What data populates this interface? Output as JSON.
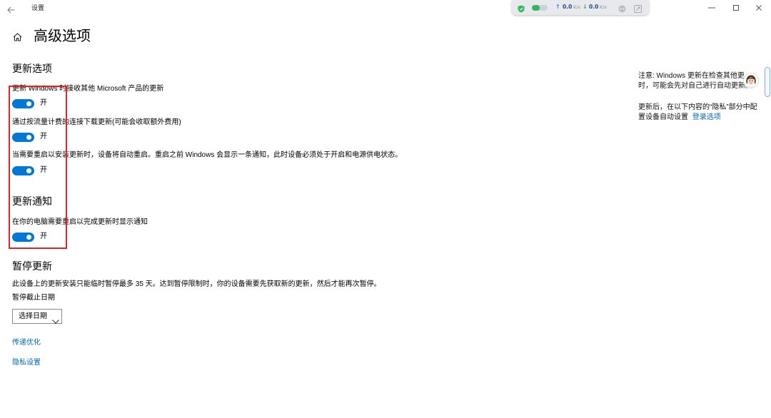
{
  "window": {
    "title": "设置"
  },
  "net_monitor": {
    "upload_value": "0.0",
    "upload_unit": "K/s",
    "download_value": "0.0",
    "download_unit": "K/s"
  },
  "page": {
    "title": "高级选项"
  },
  "update_options": {
    "heading": "更新选项",
    "toggles": [
      {
        "label": "更新 Windows 时接收其他 Microsoft 产品的更新",
        "on": true,
        "state_label": "开"
      },
      {
        "label": "通过按流量计费的连接下载更新(可能会收取额外费用)",
        "on": true,
        "state_label": "开"
      },
      {
        "label": "当需要重启以安装更新时，设备将自动重启。重启之前 Windows 会显示一条通知，此时设备必须处于开启和电源供电状态。",
        "on": true,
        "state_label": "开"
      }
    ]
  },
  "update_notifications": {
    "heading": "更新通知",
    "toggles": [
      {
        "label": "在你的电脑需要重启以完成更新时显示通知",
        "on": true,
        "state_label": "开"
      }
    ]
  },
  "pause_updates": {
    "heading": "暂停更新",
    "description": "此设备上的更新安装只能临时暂停最多 35 天。达到暂停限制时，你的设备需要先获取新的更新，然后才能再次暂停。",
    "date_label": "暂停截止日期",
    "date_select": "选择日期"
  },
  "links": {
    "delivery_optimization": "传递优化",
    "privacy_settings": "隐私设置"
  },
  "side_notes": {
    "note1_line1": "注意: Windows 更新在检查其他更",
    "note1_line2": "时，可能会先对自己进行自动更新。",
    "note2_line1": "更新后，在以下内容的“隐私”部分中配",
    "note2_line2": "置设备自动设置",
    "note2_link": "登录选项"
  },
  "icons": {
    "back": "back-arrow-icon",
    "minimize": "minimize-icon",
    "maximize": "maximize-icon",
    "close": "close-icon",
    "home": "home-icon",
    "shield": "shield-icon",
    "upload": "upload-arrow-icon",
    "download": "download-arrow-icon",
    "gamepad": "gamepad-icon",
    "resize": "resize-icon",
    "chevron": "chevron-down-icon",
    "avatar": "avatar-icon"
  },
  "colors": {
    "accent": "#0078d7",
    "link": "#0067b8",
    "annotation": "#e02424",
    "shield": "#31b665",
    "upload": "#3b7fe4",
    "download": "#31b665"
  }
}
